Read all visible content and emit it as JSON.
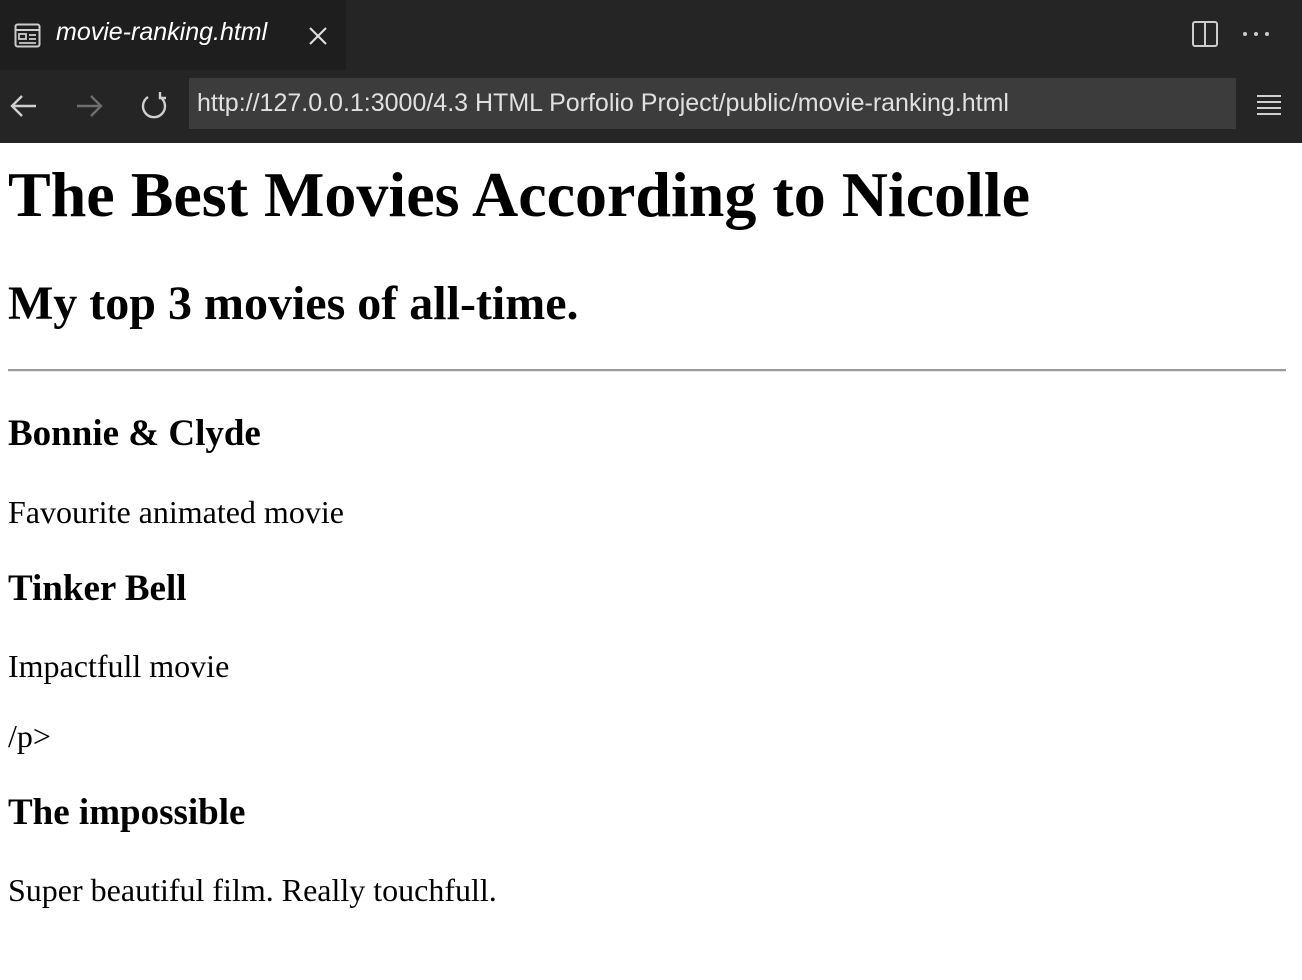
{
  "browser": {
    "tab": {
      "title": "movie-ranking.html"
    },
    "address_bar": {
      "url": "http://127.0.0.1:3000/4.3 HTML Porfolio Project/public/movie-ranking.html"
    }
  },
  "page": {
    "heading": "The Best Movies According to Nicolle",
    "subheading": "My top 3 movies of all-time.",
    "movies": [
      {
        "title": "Bonnie & Clyde",
        "description": "Favourite animated movie"
      },
      {
        "title": "Tinker Bell",
        "description": "Impactfull movie"
      },
      {
        "title": "The impossible",
        "description": "Super beautiful film. Really touchfull."
      }
    ],
    "stray_text": "/p>"
  }
}
